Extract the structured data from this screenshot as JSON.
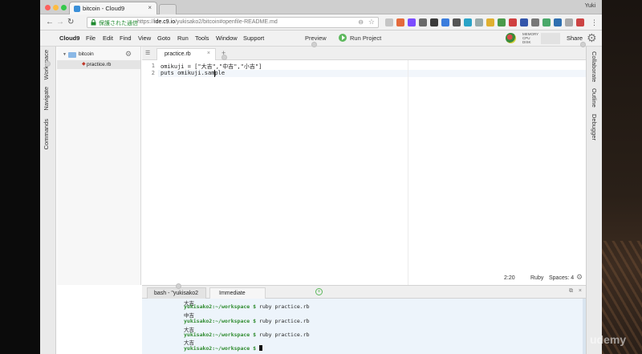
{
  "browser": {
    "tab_title": "bitcoin - Cloud9",
    "user": "Yuki",
    "secure_label": "保護された通信",
    "url_scheme": "https://",
    "url_domain": "ide.c9.io",
    "url_path": "/yukisako2/bitcoin#openfile-README.md"
  },
  "menubar": {
    "brand": "Cloud9",
    "items": [
      "File",
      "Edit",
      "Find",
      "View",
      "Goto",
      "Run",
      "Tools",
      "Window",
      "Support"
    ],
    "preview": "Preview",
    "run_project": "Run Project",
    "meters": [
      "MEMORY",
      "CPU",
      "DISK"
    ],
    "share": "Share"
  },
  "left_tabs": [
    "Workspace",
    "Navigate",
    "Commands"
  ],
  "right_tabs": [
    "Collaborate",
    "Outline",
    "Debugger"
  ],
  "tree": {
    "root": "bitcoin",
    "file": "practice.rb"
  },
  "editor": {
    "tab": "practice.rb",
    "line_numbers": [
      "1",
      "2"
    ],
    "lines": [
      "omikuji = [\"大吉\",\"中吉\",\"小吉\"]",
      "puts omikuji.sample"
    ],
    "status": {
      "position": "2:20",
      "language": "Ruby",
      "spaces": "Spaces: 4"
    }
  },
  "terminal": {
    "tabs": [
      "bash - \"yukisako2",
      "Immediate"
    ],
    "lines": [
      {
        "prompt": "",
        "text": "大吉"
      },
      {
        "prompt": "yukisako2:~/workspace $",
        "text": " ruby practice.rb"
      },
      {
        "prompt": "",
        "text": "中吉"
      },
      {
        "prompt": "yukisako2:~/workspace $",
        "text": " ruby practice.rb"
      },
      {
        "prompt": "",
        "text": "大吉"
      },
      {
        "prompt": "yukisako2:~/workspace $",
        "text": " ruby practice.rb"
      },
      {
        "prompt": "",
        "text": "大吉"
      },
      {
        "prompt": "yukisako2:~/workspace $",
        "text": " "
      }
    ]
  },
  "watermark": "udemy",
  "colors": {
    "accent_green": "#5cb85c",
    "prompt_green": "#2e8b2e",
    "terminal_bg": "#edf4fb",
    "folder_blue": "#8ab8e6"
  }
}
